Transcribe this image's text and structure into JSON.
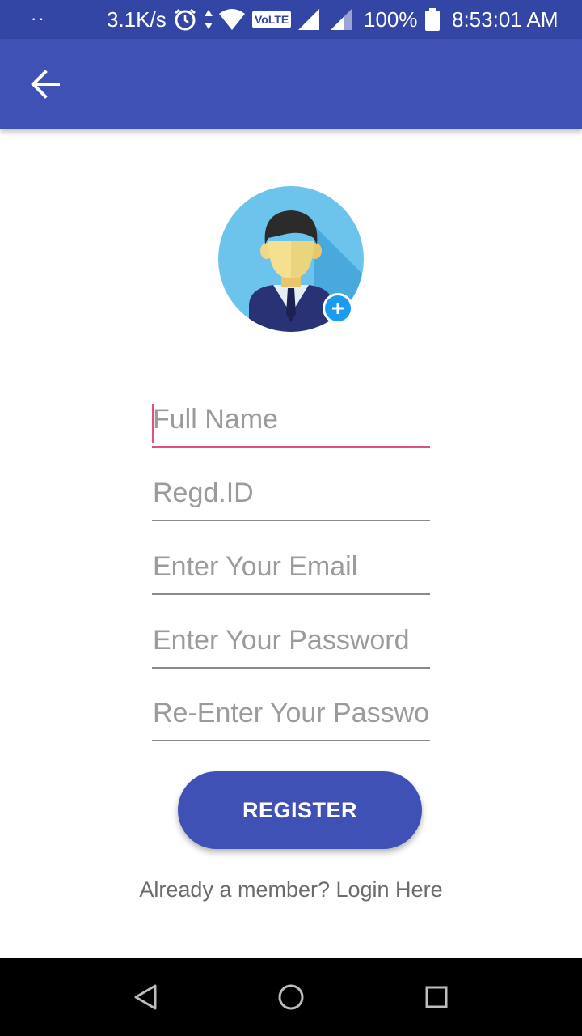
{
  "status_bar": {
    "dots": "··",
    "speed": "3.1K/s",
    "volte": "VoLTE",
    "battery": "100%",
    "time": "8:53:01 AM"
  },
  "icons": {
    "back": "arrow-back-icon",
    "avatar": "person-avatar-icon",
    "add": "add-photo-icon"
  },
  "form": {
    "full_name": {
      "placeholder": "Full Name",
      "value": ""
    },
    "regd_id": {
      "placeholder": "Regd.ID",
      "value": ""
    },
    "email": {
      "placeholder": "Enter Your Email",
      "value": ""
    },
    "password": {
      "placeholder": "Enter Your Password",
      "value": ""
    },
    "confirm_password": {
      "placeholder": "Re-Enter Your Password",
      "value": ""
    },
    "register_label": "REGISTER",
    "login_link": "Already a member? Login Here"
  },
  "colors": {
    "status_bar": "#3346a6",
    "app_bar": "#3f51b5",
    "accent": "#e04f7f",
    "button": "#3f51b5"
  }
}
